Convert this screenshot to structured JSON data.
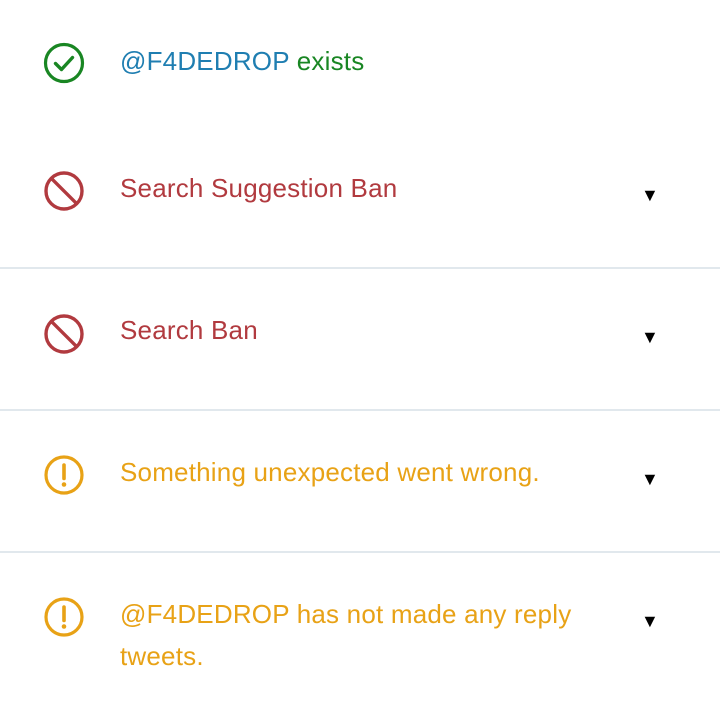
{
  "colors": {
    "handle": "#1f7eb1",
    "success": "#198623",
    "ban": "#b13a3f",
    "warning": "#e8a216",
    "divider": "#e1e8ed"
  },
  "results": [
    {
      "status": "ok",
      "icon": "check-circle-icon",
      "handle": "@F4DEDROP",
      "message": "exists",
      "expandable": false
    },
    {
      "status": "ban",
      "icon": "prohibited-icon",
      "message": "Search Suggestion Ban",
      "expandable": true,
      "toggle_glyph": "▼"
    },
    {
      "status": "ban",
      "icon": "prohibited-icon",
      "message": "Search Ban",
      "expandable": true,
      "toggle_glyph": "▼"
    },
    {
      "status": "warning",
      "icon": "exclamation-circle-icon",
      "message": "Something unexpected went wrong.",
      "expandable": true,
      "toggle_glyph": "▼"
    },
    {
      "status": "warning",
      "icon": "exclamation-circle-icon",
      "message_line1": "@F4DEDROP has not made any reply",
      "message_line2": "tweets.",
      "expandable": true,
      "toggle_glyph": "▼"
    }
  ]
}
